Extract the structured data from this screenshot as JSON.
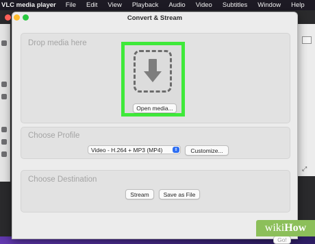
{
  "menubar": {
    "app_name": "VLC media player",
    "items": [
      "File",
      "Edit",
      "View",
      "Playback",
      "Audio",
      "Video",
      "Subtitles",
      "Window",
      "Help"
    ]
  },
  "dialog": {
    "title": "Convert & Stream",
    "drop": {
      "heading": "Drop media here",
      "open_button": "Open media...",
      "highlight_color": "#3fe93a"
    },
    "profile": {
      "heading": "Choose Profile",
      "selected": "Video - H.264 + MP3 (MP4)",
      "customize_button": "Customize..."
    },
    "destination": {
      "heading": "Choose Destination",
      "stream_button": "Stream",
      "save_button": "Save as File"
    },
    "ok_button": "Go!"
  },
  "watermark": {
    "prefix": "wiki",
    "suffix": "How",
    "color": "#8cbf5a"
  }
}
